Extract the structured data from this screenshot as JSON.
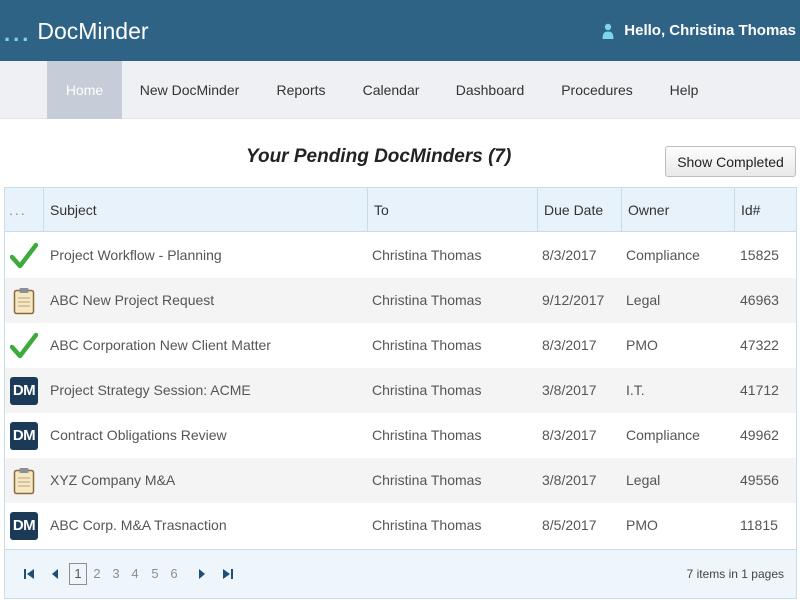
{
  "app": {
    "logo_dots": "...",
    "logo_text": "DocMinder",
    "greeting": "Hello, Christina Thomas"
  },
  "nav": {
    "items": [
      "Home",
      "New DocMinder",
      "Reports",
      "Calendar",
      "Dashboard",
      "Procedures",
      "Help"
    ],
    "active": "Home"
  },
  "main": {
    "title": "Your Pending DocMinders (7)",
    "show_completed_label": "Show Completed"
  },
  "grid": {
    "columns": [
      "...",
      "Subject",
      "To",
      "Due Date",
      "Owner",
      "Id#"
    ],
    "rows": [
      {
        "icon": "check-icon",
        "subject": "Project Workflow - Planning",
        "to": "Christina Thomas",
        "due": "8/3/2017",
        "owner": "Compliance",
        "id": "15825"
      },
      {
        "icon": "clipboard-icon",
        "subject": "ABC New Project Request",
        "to": "Christina Thomas",
        "due": "9/12/2017",
        "owner": "Legal",
        "id": "46963"
      },
      {
        "icon": "check-icon",
        "subject": "ABC Corporation New Client Matter",
        "to": "Christina Thomas",
        "due": "8/3/2017",
        "owner": "PMO",
        "id": "47322"
      },
      {
        "icon": "dm-icon",
        "subject": "Project Strategy Session: ACME",
        "to": "Christina Thomas",
        "due": "3/8/2017",
        "owner": "I.T.",
        "id": "41712"
      },
      {
        "icon": "dm-icon",
        "subject": "Contract Obligations Review",
        "to": "Christina Thomas",
        "due": "8/3/2017",
        "owner": "Compliance",
        "id": "49962"
      },
      {
        "icon": "clipboard-icon",
        "subject": "XYZ Company M&A",
        "to": "Christina Thomas",
        "due": "3/8/2017",
        "owner": "Legal",
        "id": "49556"
      },
      {
        "icon": "dm-icon",
        "subject": "ABC Corp. M&A Trasnaction",
        "to": "Christina Thomas",
        "due": "8/5/2017",
        "owner": "PMO",
        "id": "11815"
      }
    ],
    "dm_badge_text": "DM"
  },
  "pager": {
    "pages": [
      "1",
      "2",
      "3",
      "4",
      "5",
      "6"
    ],
    "current": "1",
    "info": "7 items in 1 pages"
  },
  "colors": {
    "header_bg": "#2f6385",
    "nav_active_bg": "#c6ccd8",
    "check_green": "#3cab3c",
    "dm_badge_bg": "#1b3a57"
  }
}
